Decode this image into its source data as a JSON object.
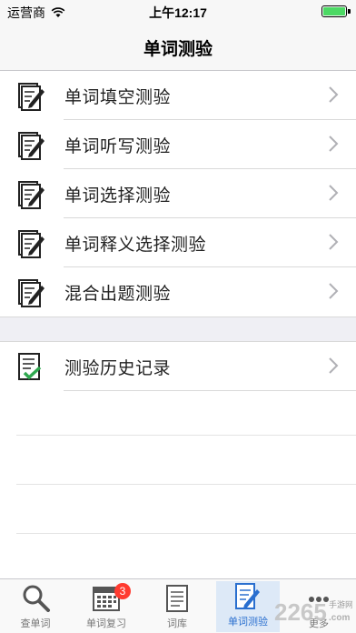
{
  "status_bar": {
    "carrier": "运营商",
    "time": "上午12:17"
  },
  "nav": {
    "title": "单词测验"
  },
  "menu": [
    {
      "label": "单词填空测验"
    },
    {
      "label": "单词听写测验"
    },
    {
      "label": "单词选择测验"
    },
    {
      "label": "单词释义选择测验"
    },
    {
      "label": "混合出题测验"
    }
  ],
  "history": {
    "label": "测验历史记录"
  },
  "tabs": [
    {
      "label": "查单词",
      "icon": "magnifier-icon"
    },
    {
      "label": "单词复习",
      "icon": "calendar-icon",
      "badge": "3"
    },
    {
      "label": "词库",
      "icon": "notepad-icon"
    },
    {
      "label": "单词测验",
      "icon": "quiz-icon",
      "active": true
    },
    {
      "label": "更多",
      "icon": "more-icon"
    }
  ],
  "colors": {
    "accent": "#2a6fcf",
    "badge": "#ff3b30",
    "battery": "#4cd964"
  },
  "watermark": {
    "text": "2265.com",
    "subtext": "手游网"
  }
}
